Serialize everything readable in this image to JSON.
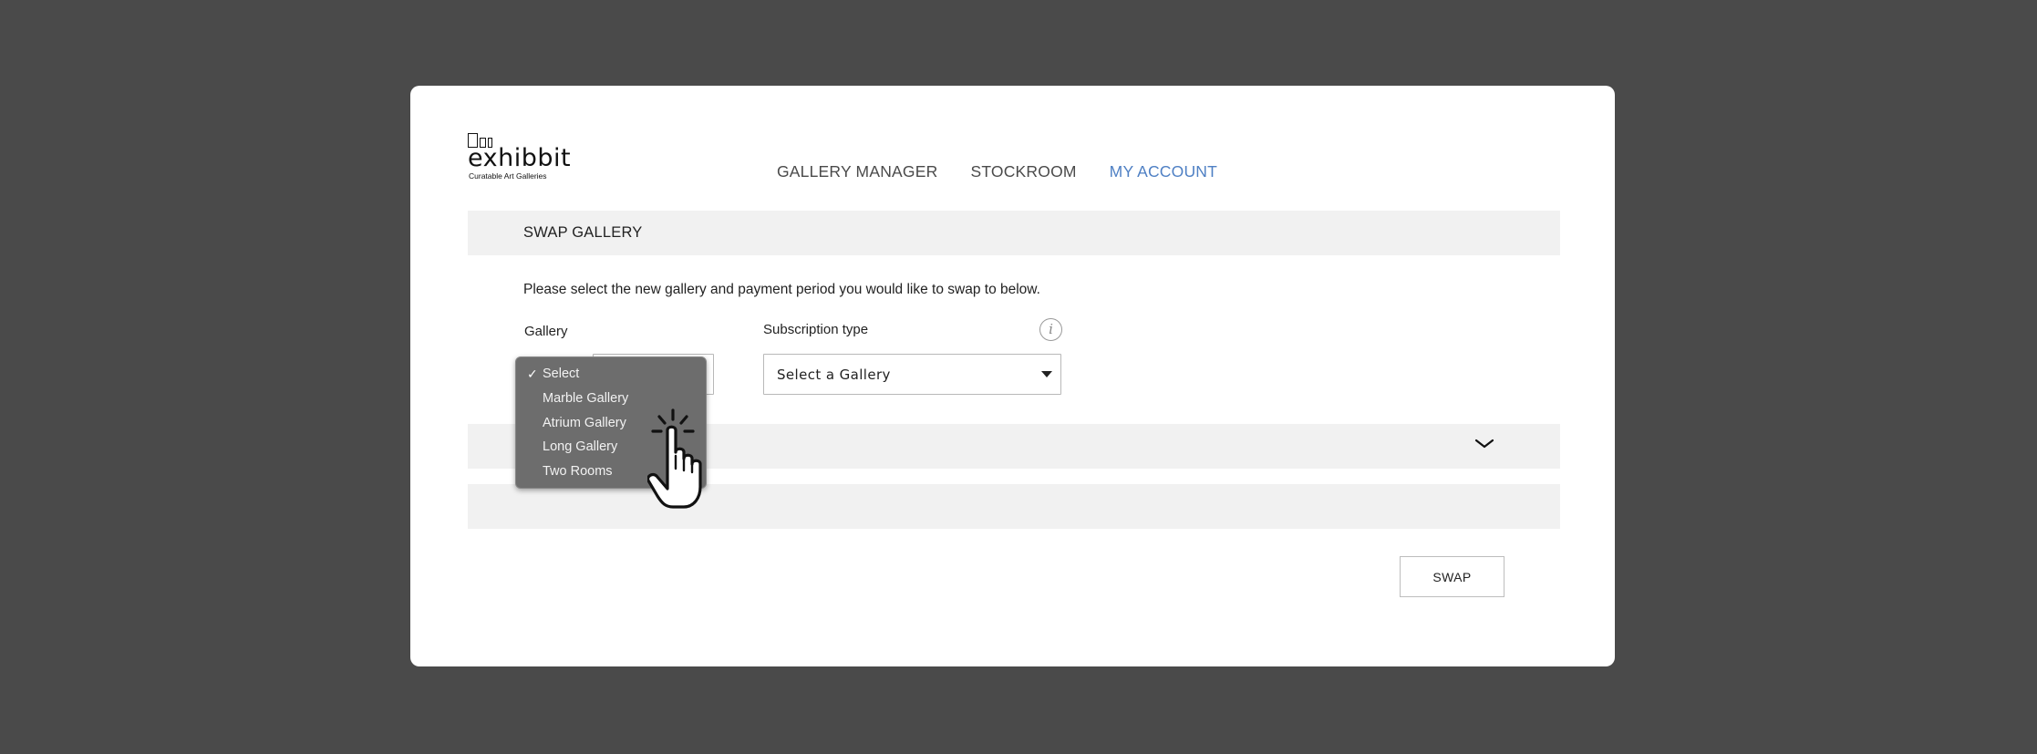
{
  "brand": {
    "name": "exhibbit",
    "tagline": "Curatable Art Galleries"
  },
  "nav": {
    "items": [
      {
        "label": "GALLERY MANAGER",
        "active": false
      },
      {
        "label": "STOCKROOM",
        "active": false
      },
      {
        "label": "MY ACCOUNT",
        "active": true
      }
    ],
    "active_color": "#4f80c4"
  },
  "swap_section": {
    "title": "SWAP GALLERY",
    "instruction": "Please select the new gallery and payment period you would like to swap to below.",
    "gallery_label": "Gallery",
    "subscription_label": "Subscription type",
    "subscription_value": "Select a Gallery",
    "info_icon": "info-icon"
  },
  "gallery_dropdown": {
    "selected": "Select",
    "options": [
      "Select",
      "Marble Gallery",
      "Atrium Gallery",
      "Long Gallery",
      "Two Rooms"
    ]
  },
  "actions": {
    "swap_label": "SWAP"
  },
  "icons": {
    "cursor": "hand-pointer-icon",
    "expand": "chevron-down-icon"
  },
  "colors": {
    "backdrop": "#4a4a4a",
    "panel": "#ffffff",
    "section_bar": "#f1f1f1",
    "dropdown": "#6d6d6d"
  }
}
